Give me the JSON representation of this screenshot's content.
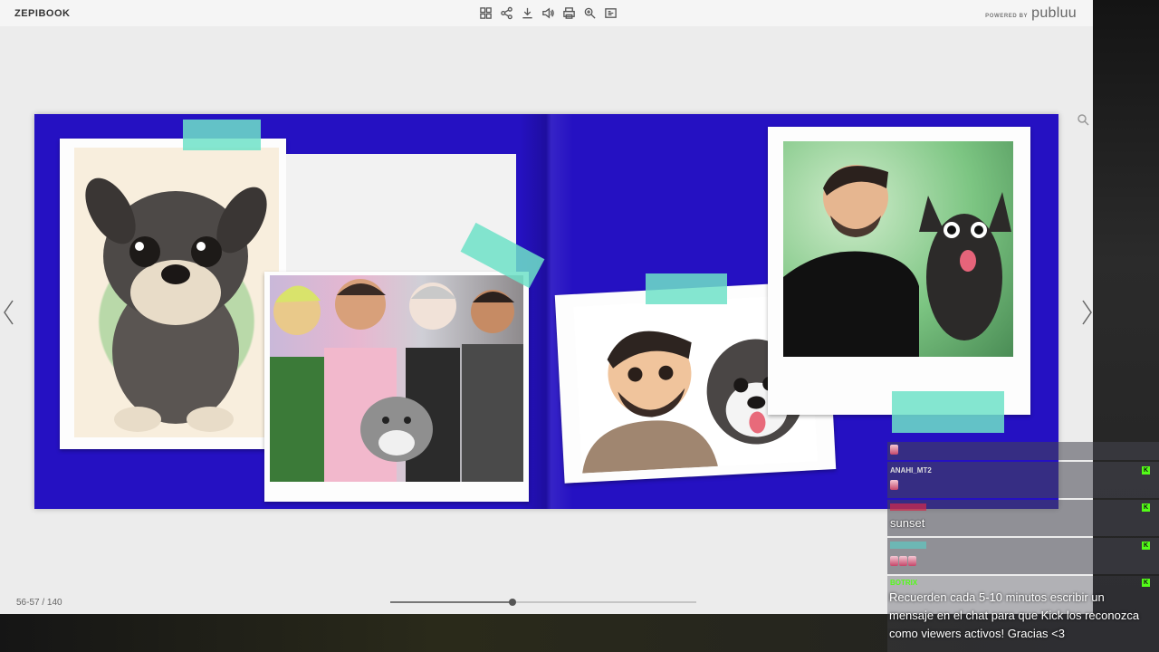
{
  "viewer": {
    "brand": "ZEPIBOOK",
    "powered_by": "POWERED BY",
    "powered_logo": "publuu",
    "toolbar": [
      {
        "name": "thumbnails-icon"
      },
      {
        "name": "share-icon"
      },
      {
        "name": "download-icon"
      },
      {
        "name": "sound-icon"
      },
      {
        "name": "print-icon"
      },
      {
        "name": "zoom-icon"
      },
      {
        "name": "fullscreen-icon"
      }
    ],
    "page_indicator": "56-57 / 140",
    "progress": 0.4,
    "colors": {
      "spread_background": "#2511c2",
      "tape": "#6ee2c8"
    }
  },
  "chat": {
    "messages": [
      {
        "user": "",
        "user_color": "#cccccc",
        "emote_count": 1,
        "text": ""
      },
      {
        "user": "ANAHI_MT2",
        "user_color": "#dddddd",
        "emote_count": 1,
        "text": ""
      },
      {
        "user": "",
        "user_color": "#d42a4a",
        "emote_count": 0,
        "text": "sunset"
      },
      {
        "user": "",
        "user_color": "#5ec8c0",
        "emote_count": 3,
        "text": ""
      },
      {
        "user": "BOTRIX",
        "user_color": "#53fc18",
        "emote_count": 0,
        "text": "Recuerden cada 5-10 minutos escribir un mensaje en el chat para que Kick los reconozca como viewers activos! Gracias <3"
      }
    ]
  }
}
